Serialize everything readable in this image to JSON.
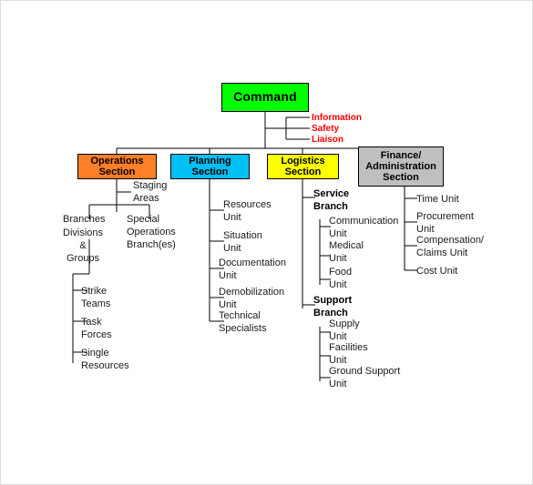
{
  "chart": {
    "title": "Incident Command System Organizational Chart",
    "type": "org-chart",
    "colors": {
      "command": "#00FF00",
      "operations": "#FF7F27",
      "planning": "#00BFF3",
      "logistics": "#FFFF00",
      "finance": "#BFBFBF",
      "command_staff_text": "#FF0000",
      "connector": "#000000",
      "page_border": "#DCDCDC"
    },
    "command": {
      "label": "Command"
    },
    "command_staff": [
      {
        "label": "Information"
      },
      {
        "label": "Safety"
      },
      {
        "label": "Liaison"
      }
    ],
    "sections": [
      {
        "key": "operations",
        "label": "Operations\nSection"
      },
      {
        "key": "planning",
        "label": "Planning\nSection"
      },
      {
        "key": "logistics",
        "label": "Logistics\nSection"
      },
      {
        "key": "finance",
        "label": "Finance/\nAdministration\nSection"
      }
    ],
    "operations_items": [
      {
        "label": "Staging\nAreas"
      },
      {
        "label": "Branches"
      },
      {
        "label": "Special\nOperations\nBranch(es)"
      },
      {
        "label": "Divisions\n&\nGroups"
      },
      {
        "label": "Strike\nTeams"
      },
      {
        "label": "Task\nForces"
      },
      {
        "label": "Single\nResources"
      }
    ],
    "planning_items": [
      {
        "label": "Resources\nUnit"
      },
      {
        "label": "Situation\nUnit"
      },
      {
        "label": "Documentation\nUnit"
      },
      {
        "label": "Demobilization\nUnit"
      },
      {
        "label": "Technical\nSpecialists"
      }
    ],
    "logistics_items": [
      {
        "label": "Service\nBranch"
      },
      {
        "label": "Communication\nUnit"
      },
      {
        "label": "Medical\nUnit"
      },
      {
        "label": "Food\nUnit"
      },
      {
        "label": "Support\nBranch"
      },
      {
        "label": "Supply\nUnit"
      },
      {
        "label": "Facilities\nUnit"
      },
      {
        "label": "Ground Support\nUnit"
      }
    ],
    "finance_items": [
      {
        "label": "Time Unit"
      },
      {
        "label": "Procurement\nUnit"
      },
      {
        "label": "Compensation/\nClaims Unit"
      },
      {
        "label": "Cost Unit"
      }
    ]
  }
}
